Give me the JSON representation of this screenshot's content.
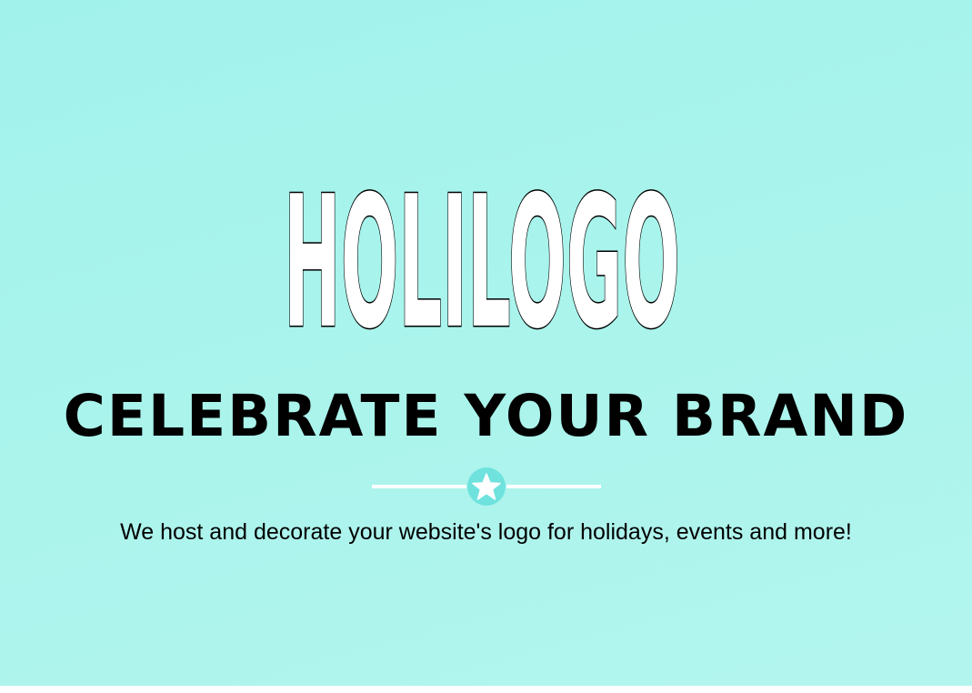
{
  "hero": {
    "logo_text": "HOLILOGO",
    "headline": "CELEBRATE YOUR BRAND",
    "tagline": "We host and decorate your website's logo for holidays, events and more!",
    "divider_icon": "star-icon"
  },
  "colors": {
    "background": "#a9f4ec",
    "accent": "#6fe2de",
    "text": "#000000",
    "divider": "#ffffff"
  }
}
